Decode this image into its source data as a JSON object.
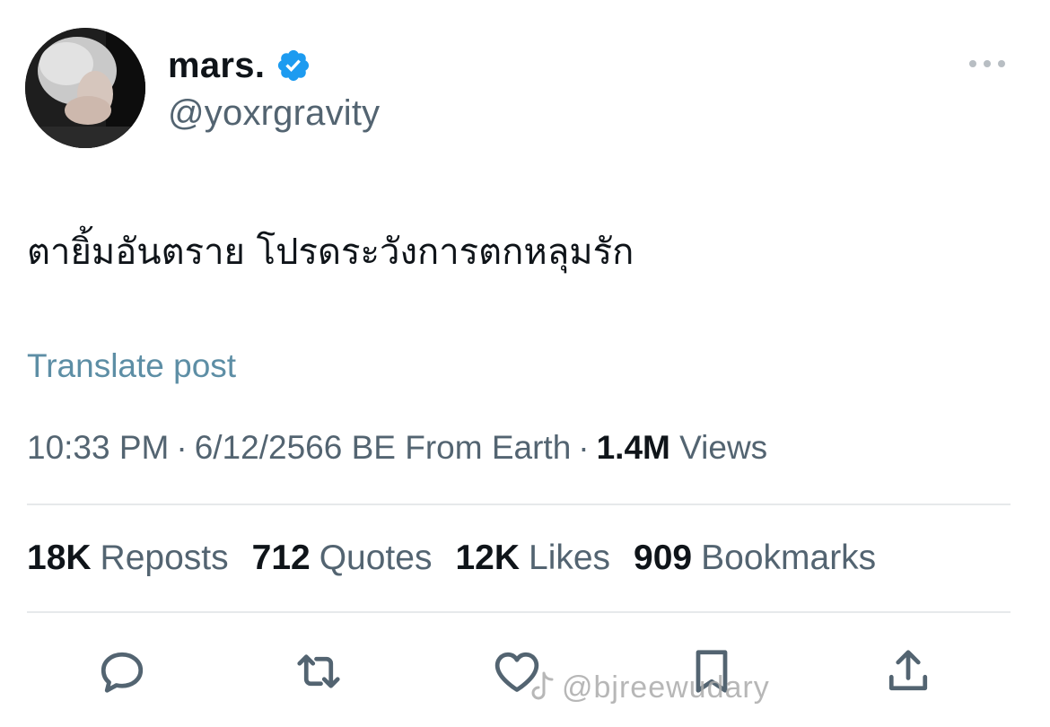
{
  "post": {
    "author": {
      "display_name": "mars.",
      "handle": "@yoxrgravity",
      "verified": true,
      "avatar": "avatar"
    },
    "text": "ตายิ้มอันตราย โปรดระวังการตกหลุมรัก",
    "translate_label": "Translate post",
    "meta": {
      "time": "10:33 PM",
      "date": "6/12/2566 BE",
      "source": "From Earth",
      "views_count": "1.4M",
      "views_label": "Views"
    },
    "stats": [
      {
        "count": "18K",
        "label": "Reposts"
      },
      {
        "count": "712",
        "label": "Quotes"
      },
      {
        "count": "12K",
        "label": "Likes"
      },
      {
        "count": "909",
        "label": "Bookmarks"
      }
    ],
    "actions": [
      "reply-icon",
      "repost-icon",
      "like-icon",
      "bookmark-icon",
      "share-icon"
    ]
  },
  "watermark": {
    "text": "@bjreewudary"
  },
  "colors": {
    "text_primary": "#0f1419",
    "text_secondary": "#536471",
    "verified": "#1d9bf0",
    "link": "#5d8ea5",
    "divider": "#e6e9eb"
  }
}
